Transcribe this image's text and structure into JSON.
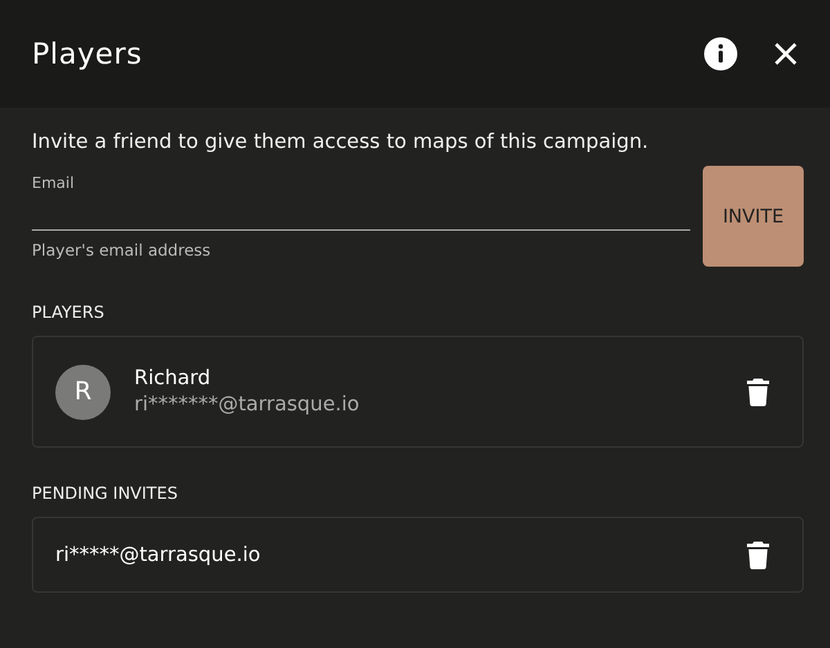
{
  "dialog": {
    "title": "Players"
  },
  "intro": "Invite a friend to give them access to maps of this campaign.",
  "email_field": {
    "label": "Email",
    "helper": "Player's email address"
  },
  "invite_button": "INVITE",
  "players_heading": "PLAYERS",
  "players": [
    {
      "initial": "R",
      "name": "Richard",
      "email": "ri*******@tarrasque.io"
    }
  ],
  "pending_heading": "PENDING INVITES",
  "pending": [
    {
      "email": "ri*****@tarrasque.io"
    }
  ]
}
